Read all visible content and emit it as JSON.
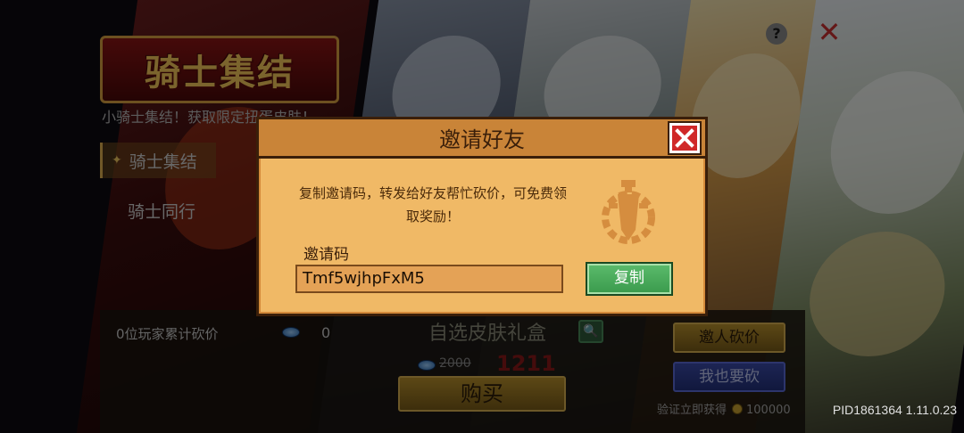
{
  "header": {
    "logo_text": "骑士集结",
    "subtitle": "小骑士集结！获取限定扭蛋皮肤！"
  },
  "sidebar": {
    "items": [
      {
        "label": "骑士集结",
        "active": true
      },
      {
        "label": "骑士同行",
        "active": false
      }
    ]
  },
  "bottom": {
    "counter_label": "0位玩家累计砍价",
    "counter_value": "0",
    "skin_box_title": "自选皮肤礼盒",
    "old_price": "2000",
    "new_price": "1211",
    "buy_label": "购买",
    "invite_label": "邀人砍价",
    "cut_label": "我也要砍",
    "verify_text": "验证立即获得",
    "verify_reward": "100000",
    "build_info": "PID1861364 1.11.0.23"
  },
  "modal": {
    "title": "邀请好友",
    "description": "复制邀请码，转发给好友帮忙砍价，可免费领取奖励！",
    "code_label": "邀请码",
    "code_value": "Tmf5wjhpFxM5",
    "copy_label": "复制"
  },
  "icons": {
    "close": "close-icon",
    "help": "help-icon",
    "gem": "gem-icon",
    "coin": "coin-icon",
    "zoom": "magnifier-icon",
    "emblem": "sword-gear-emblem-icon"
  },
  "colors": {
    "modal_bg": "#f0b966",
    "modal_header": "#c98438",
    "close_red": "#d02828",
    "copy_green": "#4cac5c",
    "price_red": "#8a1818"
  }
}
